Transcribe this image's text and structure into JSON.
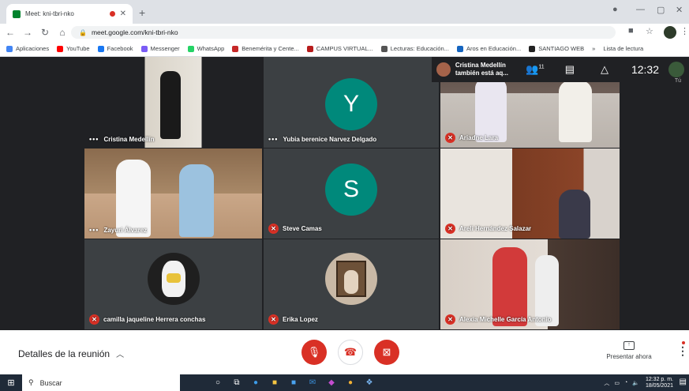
{
  "browser": {
    "tab_title": "Meet: kni-tbri-nko",
    "url": "meet.google.com/kni-tbri-nko",
    "bookmarks": [
      {
        "label": "Aplicaciones",
        "color": "#4285f4"
      },
      {
        "label": "YouTube",
        "color": "#ff0000"
      },
      {
        "label": "Facebook",
        "color": "#1877f2"
      },
      {
        "label": "Messenger",
        "color": "#7b5cf5"
      },
      {
        "label": "WhatsApp",
        "color": "#25d366"
      },
      {
        "label": "Benemérita y Cente...",
        "color": "#c62828"
      },
      {
        "label": "CAMPUS VIRTUAL...",
        "color": "#b71c1c"
      },
      {
        "label": "Lecturas: Educación...",
        "color": "#555555"
      },
      {
        "label": "Aros en Educación...",
        "color": "#1565c0"
      },
      {
        "label": "SANTIAGO WEB",
        "color": "#222222"
      }
    ],
    "bookmarks_more": "»",
    "reading_list": "Lista de lectura"
  },
  "meet_header": {
    "notification_name": "Cristina Medellín",
    "notification_text": "también está aq...",
    "participants_count": "11",
    "clock": "12:32",
    "self_label": "Tú"
  },
  "participants": [
    {
      "name": "Cristina Medellín",
      "status": "speaking"
    },
    {
      "name": "Yubia berenice Narvez Delgado",
      "status": "speaking",
      "initial": "Y"
    },
    {
      "name": "Ariadne Lara",
      "status": "muted"
    },
    {
      "name": "Zayuri Álvarez",
      "status": "speaking"
    },
    {
      "name": "Steve Camas",
      "status": "muted",
      "initial": "S"
    },
    {
      "name": "Areli Hernández Salazar",
      "status": "muted"
    },
    {
      "name": "camilla jaqueline Herrera conchas",
      "status": "muted"
    },
    {
      "name": "Erika Lopez",
      "status": "muted"
    },
    {
      "name": "Alexia Michelle García Antonio",
      "status": "muted"
    }
  ],
  "bottom": {
    "details_label": "Detalles de la reunión",
    "present_label": "Presentar ahora"
  },
  "taskbar": {
    "search_placeholder": "Buscar",
    "time": "12:32 p. m.",
    "date": "18/05/2021"
  },
  "colors": {
    "meet_bg": "#202124",
    "danger": "#d93025",
    "avatar_teal": "#00897b"
  }
}
